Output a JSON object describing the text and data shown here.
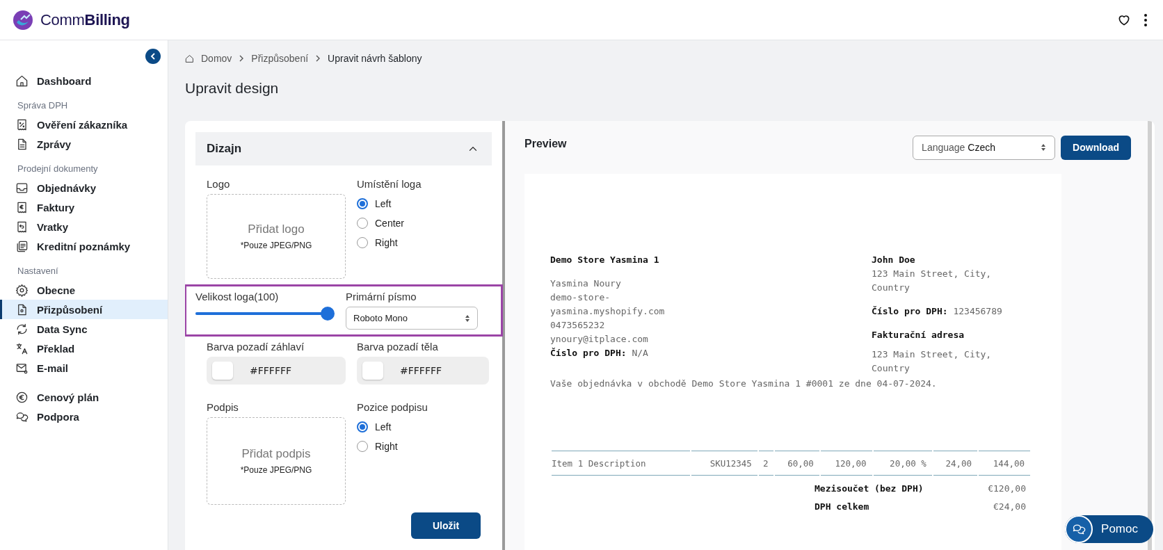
{
  "header": {
    "brand": "Comm**Billing**"
  },
  "sidebar": {
    "sections": [
      {
        "items": [
          {
            "label": "Dashboard",
            "selected": false
          }
        ]
      },
      {
        "heading": "Správa DPH",
        "items": [
          {
            "label": "Ověření zákazníka",
            "selected": false
          },
          {
            "label": "Zprávy",
            "selected": false
          }
        ]
      },
      {
        "heading": "Prodejní dokumenty",
        "items": [
          {
            "label": "Objednávky",
            "selected": false
          },
          {
            "label": "Faktury",
            "selected": false
          },
          {
            "label": "Vratky",
            "selected": false
          },
          {
            "label": "Kreditní poznámky",
            "selected": false
          }
        ]
      },
      {
        "heading": "Nastavení",
        "items": [
          {
            "label": "Obecne",
            "selected": false
          },
          {
            "label": "Přizpůsobení",
            "selected": true
          },
          {
            "label": "Data Sync",
            "selected": false
          },
          {
            "label": "Překlad",
            "selected": false
          },
          {
            "label": "E-mail",
            "selected": false
          }
        ]
      },
      {
        "items": [
          {
            "label": "Cenový plán",
            "selected": false
          },
          {
            "label": "Podpora",
            "selected": false
          }
        ]
      }
    ]
  },
  "breadcrumb": [
    "Domov",
    "Přizpůsobení",
    "Upravit návrh šablony"
  ],
  "page_title": "Upravit design",
  "design": {
    "title": "Dizajn",
    "expanded": true,
    "logo": {
      "label": "Logo",
      "upload_title": "Přidat logo",
      "upload_hint": "*Pouze JPEG/PNG"
    },
    "logo_position": {
      "label": "Umístění loga",
      "options": [
        {
          "label": "Left",
          "selected": true
        },
        {
          "label": "Center",
          "selected": false
        },
        {
          "label": "Right",
          "selected": false
        }
      ]
    },
    "logo_size": {
      "label": "Velikost loga(100)",
      "level": 1
    },
    "primary_font": {
      "label": "Primární písmo",
      "value": "Roboto Mono"
    },
    "header_bg": {
      "label": "Barva pozadí záhlaví",
      "value": "#FFFFFF"
    },
    "body_bg": {
      "label": "Barva pozadí těla",
      "value": "#FFFFFF"
    },
    "signature": {
      "label": "Podpis",
      "upload_title": "Přidat podpis",
      "upload_hint": "*Pouze JPEG/PNG"
    },
    "signature_position": {
      "label": "Pozice podpisu",
      "options": [
        {
          "label": "Left",
          "selected": true
        },
        {
          "label": "Right",
          "selected": false
        }
      ]
    },
    "save_button": "Uložit"
  },
  "preview": {
    "title": "Preview",
    "language": {
      "label": "Language",
      "value": "Czech"
    },
    "download_button": "Download",
    "invoice": {
      "store_name": "Demo Store Yasmina 1",
      "store_lines": [
        "Yasmina Noury",
        "demo-store-",
        "yasmina.myshopify.com",
        "0473565232",
        "ynoury@itplace.com"
      ],
      "store_vat": "**Číslo pro DPH:** N/A",
      "customer_name": "John Doe",
      "customer_address": [
        "123 Main Street, City,",
        "Country"
      ],
      "customer_vat": "**Číslo pro DPH:** 123456789",
      "billing_heading": "Fakturační adresa",
      "billing_address": [
        "123 Main Street, City,",
        "Country"
      ],
      "order_note": "Vaše objednávka v obchodě Demo Store Yasmina 1 #0001 ze dne 04-07-2024.",
      "item_row": [
        "Item 1 Description",
        "SKU12345",
        "2",
        "60,00",
        "120,00",
        "20,00 %",
        "24,00",
        "144,00"
      ],
      "totals": [
        {
          "label": "Mezisoučet (bez DPH)",
          "value": "€120,00"
        },
        {
          "label": "DPH celkem",
          "value": "€24,00"
        }
      ]
    }
  },
  "help_button": "Pomoc"
}
